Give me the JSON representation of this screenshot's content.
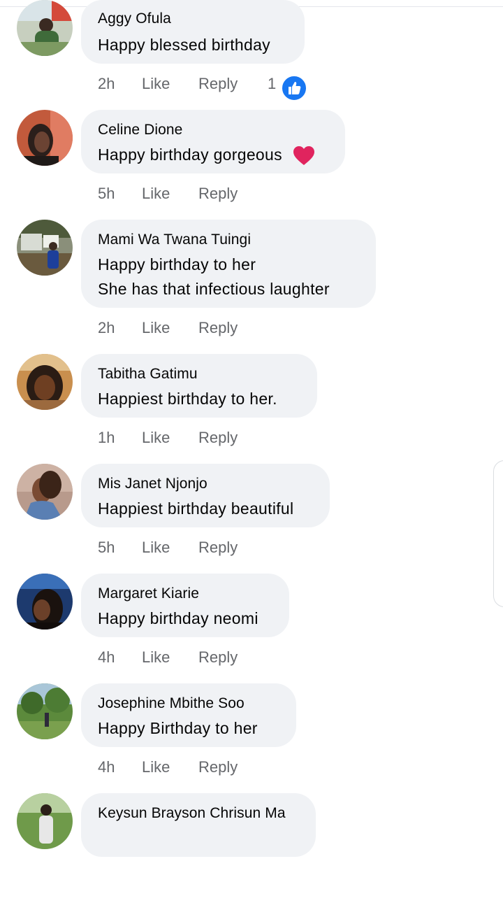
{
  "comments": [
    {
      "name": "Aggy Ofula",
      "lines": [
        "Happy blessed birthday"
      ],
      "time": "2h",
      "like": "Like",
      "reply": "Reply",
      "reaction_count": "1"
    },
    {
      "name": "Celine Dione",
      "lines": [
        "Happy birthday gorgeous"
      ],
      "time": "5h",
      "like": "Like",
      "reply": "Reply"
    },
    {
      "name": "Mami Wa Twana Tuingi",
      "lines": [
        "Happy birthday to her",
        "She has that infectious laughter"
      ],
      "time": "2h",
      "like": "Like",
      "reply": "Reply"
    },
    {
      "name": "Tabitha Gatimu",
      "lines": [
        "Happiest birthday to her."
      ],
      "time": "1h",
      "like": "Like",
      "reply": "Reply"
    },
    {
      "name": "Mis Janet Njonjo",
      "lines": [
        "Happiest birthday beautiful"
      ],
      "time": "5h",
      "like": "Like",
      "reply": "Reply"
    },
    {
      "name": "Margaret Kiarie",
      "lines": [
        "Happy birthday neomi"
      ],
      "time": "4h",
      "like": "Like",
      "reply": "Reply"
    },
    {
      "name": "Josephine Mbithe Soo",
      "lines": [
        "Happy Birthday to her"
      ],
      "time": "4h",
      "like": "Like",
      "reply": "Reply"
    },
    {
      "name": "Keysun Brayson Chrisun Ma",
      "lines": [],
      "time": "",
      "like": "",
      "reply": ""
    }
  ],
  "icons": {
    "heart": "heart-emoji-icon",
    "like_reaction": "thumbs-up-reaction-icon"
  },
  "colors": {
    "bubble": "#f0f2f5",
    "meta": "#65676b",
    "like_blue": "#1877f2",
    "heart_red": "#e0245e"
  }
}
